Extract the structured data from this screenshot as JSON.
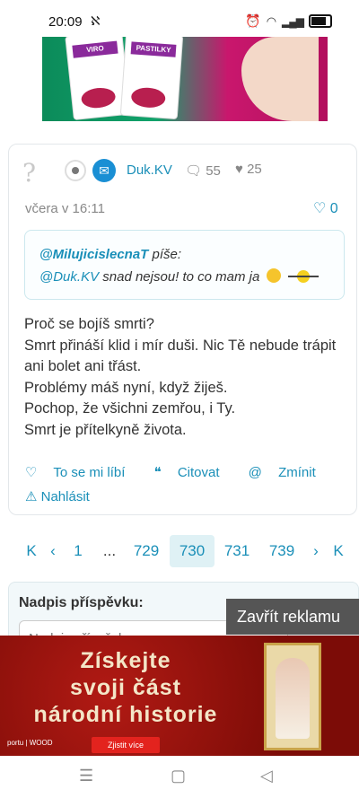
{
  "status": {
    "time": "20:09",
    "note_icon": "N",
    "icons": [
      "alarm-icon",
      "wifi-icon",
      "signal-icon",
      "battery-icon"
    ]
  },
  "top_ad": {
    "brand": "VIRO",
    "product": "PASTILKY"
  },
  "post": {
    "username": "Duk.KV",
    "comments": "55",
    "hearts": "25",
    "date": "včera v 16:11",
    "likes": "0",
    "quote": {
      "author": "@MilujicislecnaT",
      "verb": "píše:",
      "mention": "@Duk.KV",
      "text": "snad nejsou! to co mam ja"
    },
    "body": [
      "Proč se bojíš smrti?",
      "Smrt přináší klid i mír duši. Nic Tě nebude trápit",
      "ani bolet ani třást.",
      "Problémy máš nyní, když žiješ.",
      "Pochop, že všichni zemřou, i Ty.",
      "Smrt je přítelkyně života."
    ],
    "actions": {
      "like": "To se mi líbí",
      "quote": "Citovat",
      "mention": "Zmínit",
      "report": "Nahlásit"
    }
  },
  "pager": {
    "first": "K",
    "prev": "‹",
    "p1": "1",
    "dots": "...",
    "p729": "729",
    "p730": "730",
    "p731": "731",
    "p739": "739",
    "next": "›",
    "last": "Ꮧ"
  },
  "form": {
    "label": "Nadpis příspěvku:",
    "placeholder": "Nadpis příspěvku"
  },
  "close_ad": "Zavřít reklamu",
  "bottom_ad": {
    "line1": "Získejte",
    "line2": "svoji část",
    "line3": "národní historie",
    "button": "Zjistit více",
    "logo": "portu | WOOD"
  }
}
